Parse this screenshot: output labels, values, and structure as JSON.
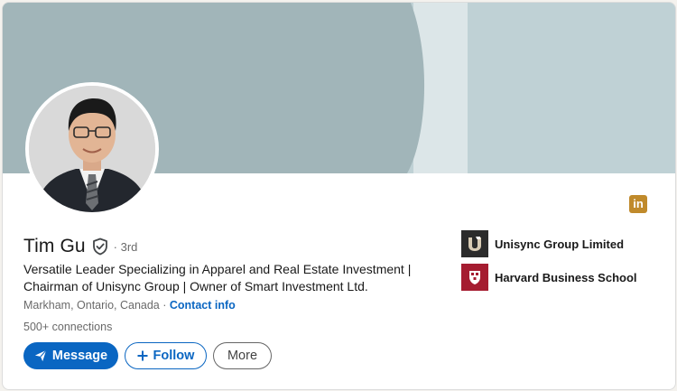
{
  "profile": {
    "name": "Tim Gu",
    "degree": "· 3rd",
    "headline": "Versatile Leader Specializing in Apparel and Real Estate Investment | Chairman of Unisync Group | Owner of Smart Investment Ltd.",
    "location": "Markham, Ontario, Canada",
    "location_separator": " · ",
    "contact_info_label": "Contact info",
    "connections": "500+ connections"
  },
  "actions": {
    "message_label": "Message",
    "follow_label": "Follow",
    "more_label": "More"
  },
  "organizations": [
    {
      "name": "Unisync Group Limited",
      "icon": "unisync-logo"
    },
    {
      "name": "Harvard Business School",
      "icon": "harvard-shield-logo"
    }
  ],
  "brand_badge": {
    "text": "in",
    "icon": "linkedin-icon"
  },
  "colors": {
    "accent": "#0a66c2",
    "banner_light": "#bfd1d5",
    "banner_dark": "#a1b5b9",
    "linkedin_badge": "#c08a2b",
    "harvard_crimson": "#a51c30"
  }
}
